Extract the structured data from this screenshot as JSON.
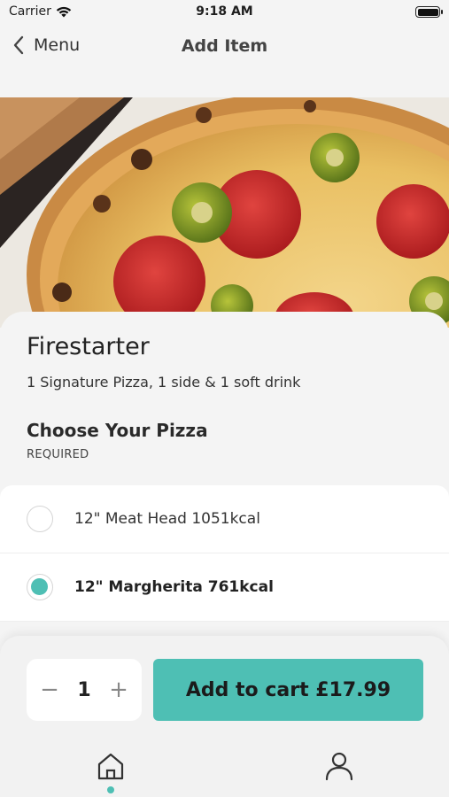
{
  "status_bar": {
    "carrier": "Carrier",
    "time": "9:18 AM"
  },
  "nav": {
    "back_label": "Menu",
    "title": "Add Item"
  },
  "item": {
    "name": "Firestarter",
    "description": "1 Signature Pizza, 1 side & 1 soft drink"
  },
  "section": {
    "title": "Choose Your Pizza",
    "requirement": "REQUIRED"
  },
  "options": [
    {
      "label": "12\" Meat Head 1051kcal",
      "selected": false
    },
    {
      "label": "12\" Margherita 761kcal",
      "selected": true
    }
  ],
  "cart": {
    "quantity": "1",
    "minus": "−",
    "plus": "+",
    "button_label": "Add to cart £17.99"
  },
  "tabbar": {
    "active": "home"
  },
  "colors": {
    "accent": "#4ebfb4",
    "background": "#f4f4f4"
  },
  "icons": [
    "wifi-icon",
    "battery-icon",
    "chevron-left-icon",
    "home-icon",
    "user-icon"
  ]
}
